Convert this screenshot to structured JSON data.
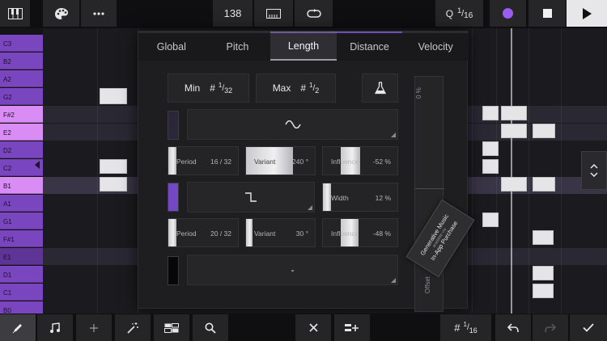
{
  "toolbar": {
    "tempo": "138",
    "quantize_q": "Q",
    "quantize_num": "1",
    "quantize_den": "16"
  },
  "keyboard": {
    "keys": [
      "C3",
      "B2",
      "A2",
      "G2",
      "F#2",
      "E2",
      "D2",
      "C2",
      "B1",
      "A1",
      "G1",
      "F#1",
      "E1",
      "D1",
      "C1",
      "B0"
    ]
  },
  "panel": {
    "tabs": [
      "Global",
      "Pitch",
      "Length",
      "Distance",
      "Velocity"
    ],
    "active_tab": "Length",
    "min_label": "Min",
    "min_num": "1",
    "min_den": "32",
    "max_label": "Max",
    "max_num": "1",
    "max_den": "2",
    "row1": {
      "period_label": "Period",
      "period_value": "16 / 32",
      "variant_label": "Variant",
      "variant_value": "240 °",
      "influence_label": "Influence",
      "influence_value": "-52 %"
    },
    "row2": {
      "width_label": "Width",
      "width_value": "12 %"
    },
    "row3": {
      "period_label": "Period",
      "period_value": "20 / 32",
      "variant_label": "Variant",
      "variant_value": "30 °",
      "influence_label": "Influence",
      "influence_value": "-48 %"
    },
    "row3_wave_symbol": "-",
    "offset_top_value": "0 %",
    "offset_label": "Offset"
  },
  "promo": {
    "line1": "Generative Music",
    "line2": "available via",
    "line3": "In-App Purchase"
  },
  "bottom": {
    "grid_num": "1",
    "grid_den": "16"
  },
  "colors": {
    "accent_purple": "#7a46c0",
    "record_dot": "#9b5cf0",
    "note": "#e5e5e8"
  }
}
